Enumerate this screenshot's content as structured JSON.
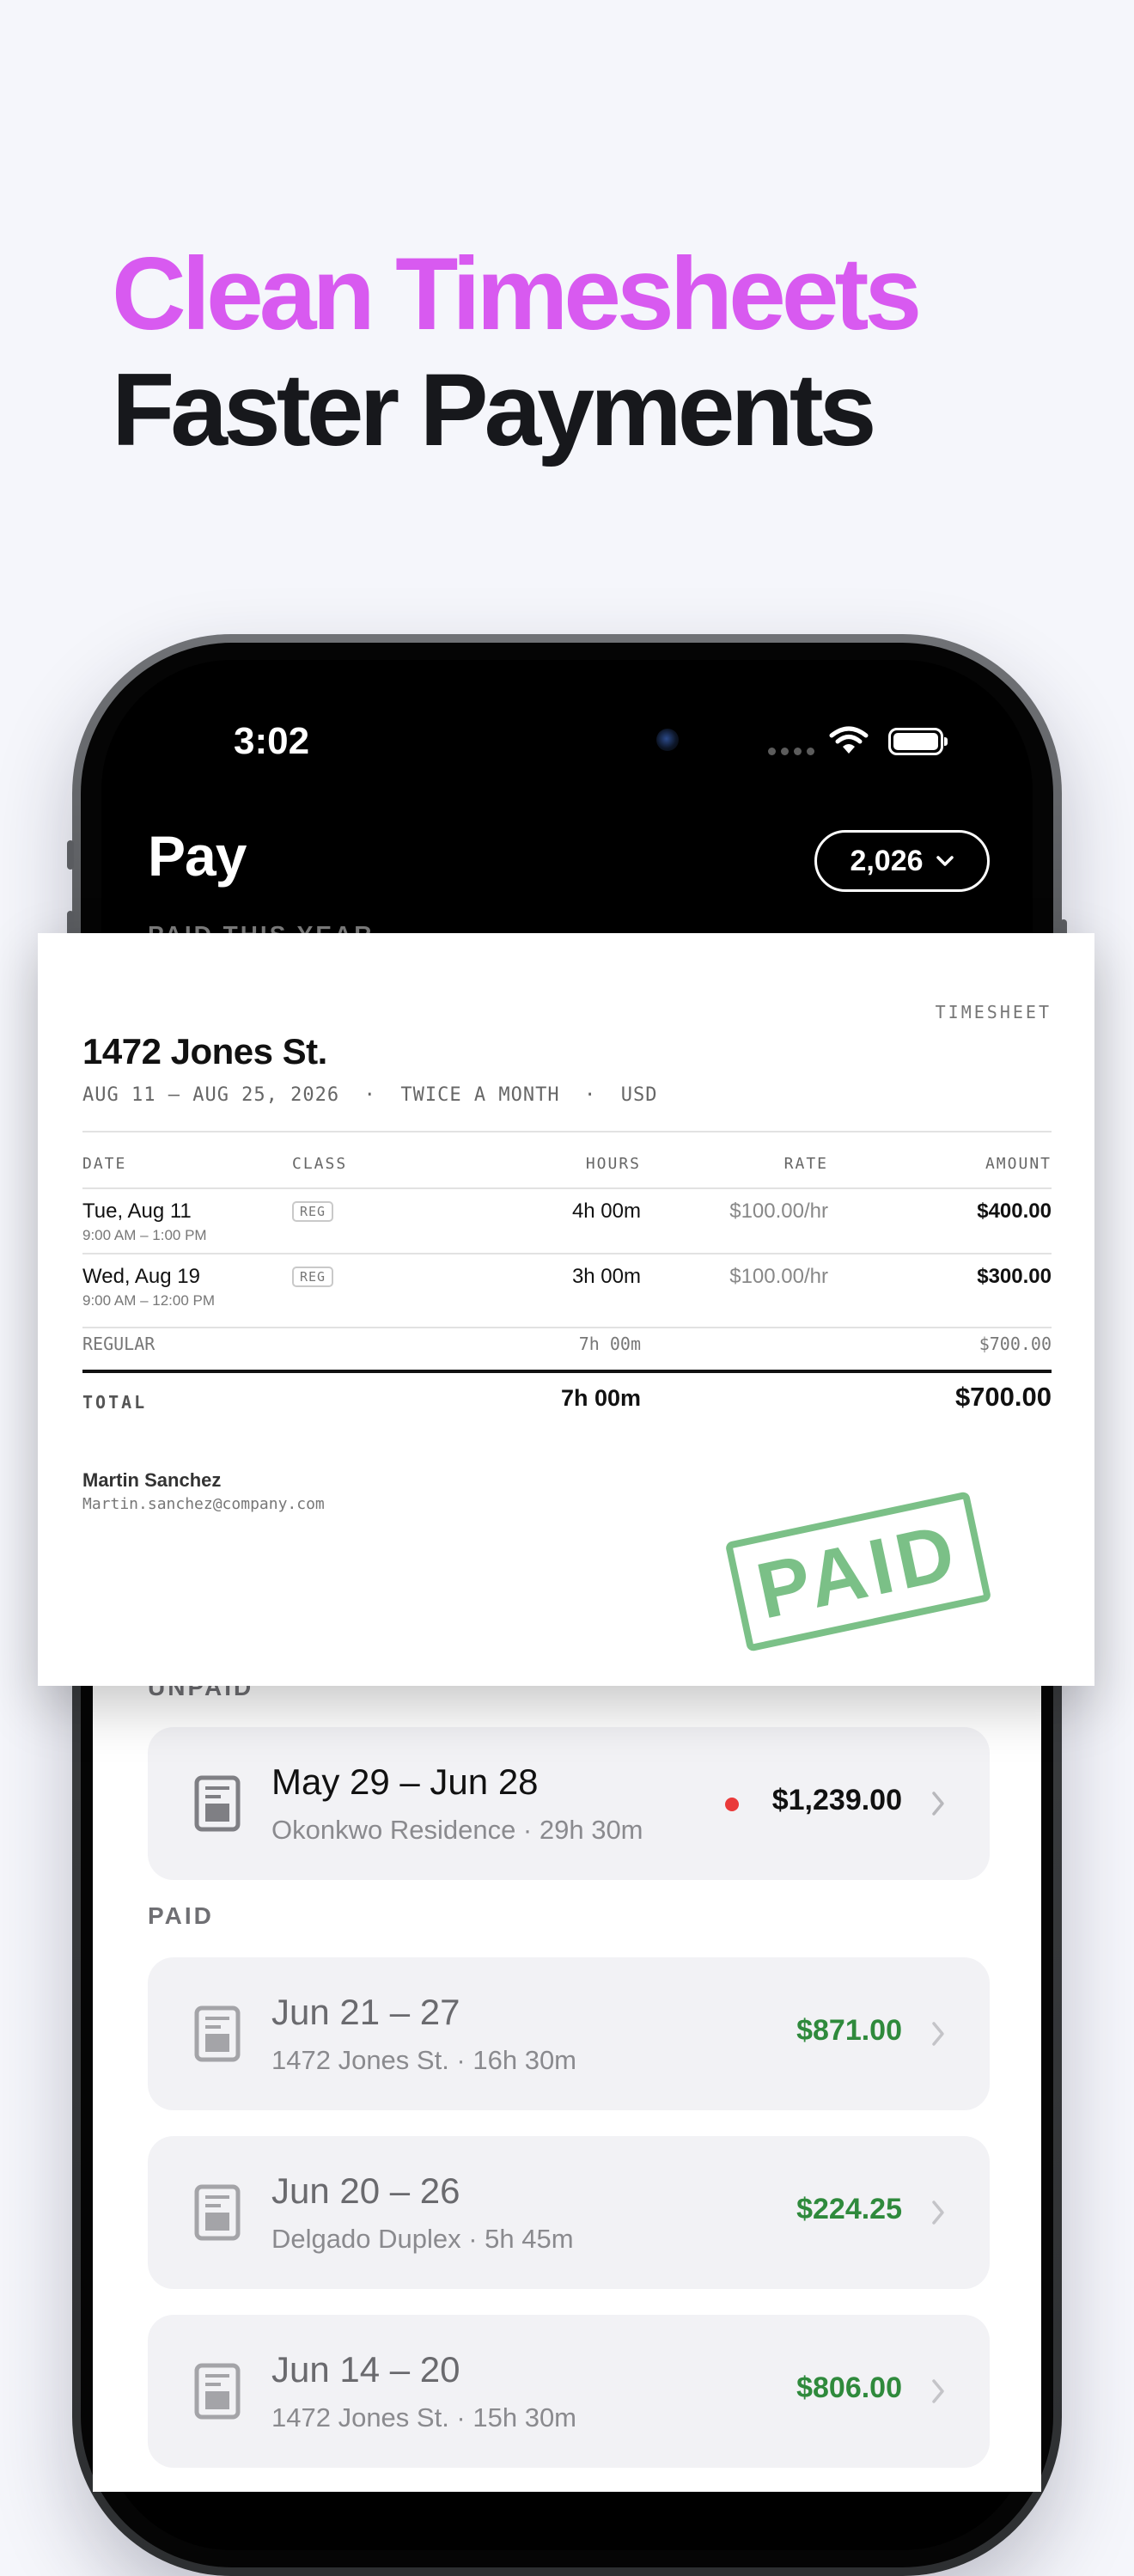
{
  "headline": {
    "line1": "Clean Timesheets",
    "line2": "Faster Payments",
    "line1_color": "#d85af0",
    "line2_color": "#17181c"
  },
  "status_bar": {
    "time": "3:02",
    "icons": [
      "signal-icon",
      "wifi-icon",
      "battery-icon"
    ]
  },
  "pay_screen": {
    "title": "Pay",
    "year_button": "2,026",
    "paid_this_year_label": "PAID THIS YEAR",
    "unpaid_label": "UNPAID",
    "paid_label": "PAID",
    "unpaid_items": [
      {
        "title": "May 29 – Jun 28",
        "subtitle": "Okonkwo Residence · 29h 30m",
        "amount": "$1,239.00",
        "status_color": "#ea3a3a"
      }
    ],
    "paid_items": [
      {
        "title": "Jun 21 – 27",
        "subtitle": "1472 Jones St. · 16h 30m",
        "amount": "$871.00"
      },
      {
        "title": "Jun 20 – 26",
        "subtitle": "Delgado Duplex · 5h 45m",
        "amount": "$224.25"
      },
      {
        "title": "Jun 14 – 20",
        "subtitle": "1472 Jones St. · 15h 30m",
        "amount": "$806.00"
      }
    ],
    "paid_amount_color": "#2f8a3c"
  },
  "timesheet": {
    "label": "TIMESHEET",
    "title": "1472 Jones St.",
    "meta": "AUG 11 — AUG 25, 2026  ·  TWICE A MONTH  ·  USD",
    "columns": {
      "date": "DATE",
      "class": "CLASS",
      "hours": "HOURS",
      "rate": "RATE",
      "amount": "AMOUNT"
    },
    "rows": [
      {
        "date": "Tue, Aug 11",
        "time": "9:00 AM – 1:00 PM",
        "class": "REG",
        "hours": "4h 00m",
        "rate": "$100.00/hr",
        "amount": "$400.00"
      },
      {
        "date": "Wed, Aug 19",
        "time": "9:00 AM – 12:00 PM",
        "class": "REG",
        "hours": "3h 00m",
        "rate": "$100.00/hr",
        "amount": "$300.00"
      }
    ],
    "subtotal": {
      "label": "REGULAR",
      "hours": "7h 00m",
      "amount": "$700.00"
    },
    "total": {
      "label": "TOTAL",
      "hours": "7h 00m",
      "amount": "$700.00"
    },
    "worker_name": "Martin Sanchez",
    "worker_email": "Martin.sanchez@company.com",
    "stamp": "PAID",
    "stamp_color": "#69b877"
  }
}
